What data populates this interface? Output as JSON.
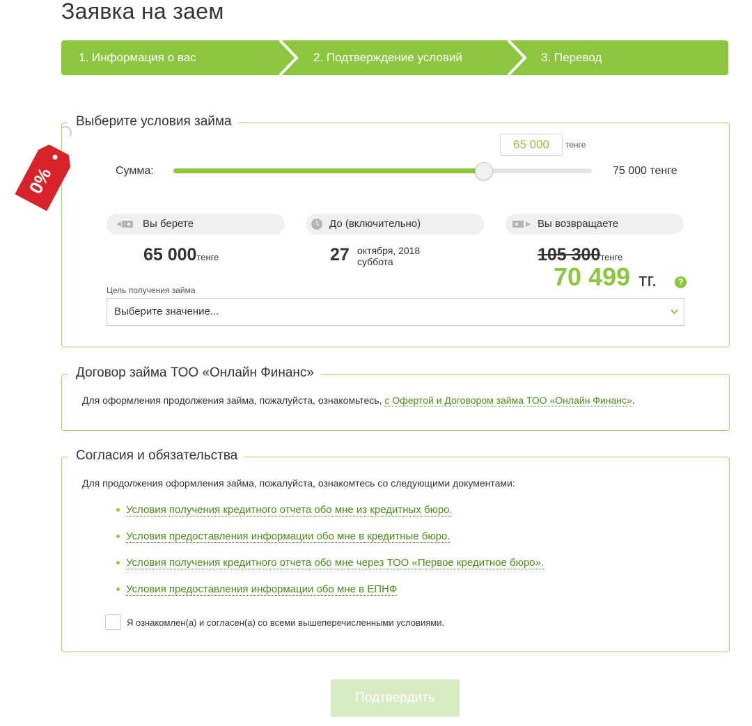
{
  "page_title": "Заявка на заем",
  "steps": [
    {
      "label": "1. Информация о вас"
    },
    {
      "label": "2. Подтверждение условий"
    },
    {
      "label": "3. Перевод"
    }
  ],
  "promo_tag": "0%",
  "loan_terms": {
    "legend": "Выберите условия займа",
    "amount_label": "Сумма:",
    "slider": {
      "value": "65 000",
      "value_unit": "тенге",
      "min": 0,
      "max": 75000,
      "current": 65000,
      "max_label": "75 000 тенге"
    },
    "take": {
      "label": "Вы берете",
      "amount": "65 000",
      "unit": "тенге"
    },
    "until": {
      "label": "До (включительно)",
      "day": "27",
      "month_year": "октября, 2018",
      "weekday": "суббота"
    },
    "return": {
      "label": "Вы возвращаете",
      "old_amount": "105 300",
      "old_unit": "тенге",
      "new_amount": "70 499",
      "new_unit": "тг.",
      "help": "?"
    },
    "purpose_label": "Цель получения займа",
    "purpose_placeholder": "Выберите значение..."
  },
  "contract": {
    "legend": "Договор займа ТОО «Онлайн Финанс»",
    "text": "Для оформления продолжения займа, пожалуйста, ознакомьтесь,",
    "link": "с Офертой и Договором займа ТОО «Онлайн Финанс»",
    "tail": "."
  },
  "consents": {
    "legend": "Согласия и обязательства",
    "intro": "Для продолжения оформления займа, пожалуйста, ознакомтесь со следующими документами:",
    "documents": [
      "Условия получения кредитного отчета обо мне из кредитных бюро.",
      "Условия предоставления информации обо мне в кредитные бюро.",
      "Условия получения кредитного отчета обо мне через ТОО «Первое кредитное бюро».",
      "Условия предоставления информации обо мне в ЕПНФ"
    ],
    "agree_label": "Я ознакомлен(а) и согласен(а) со всеми вышеперечисленными условиями."
  },
  "submit_label": "Подтвердить",
  "colors": {
    "accent": "#8cc63f",
    "link": "#4d8a1c",
    "tag": "#d7232a",
    "button_disabled": "#d7ebc2"
  }
}
